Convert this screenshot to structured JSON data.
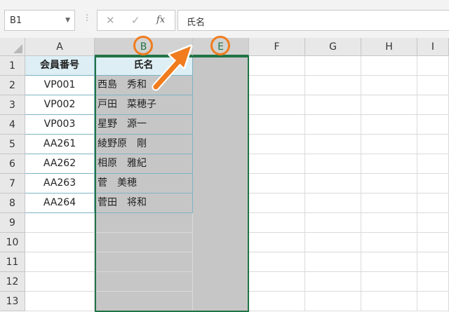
{
  "formula_bar": {
    "name_box": "B1",
    "formula": "氏名",
    "fx_label": "fx"
  },
  "columns": [
    "A",
    "B",
    "E",
    "F",
    "G",
    "H",
    "I"
  ],
  "rows": [
    "1",
    "2",
    "3",
    "4",
    "5",
    "6",
    "7",
    "8",
    "9",
    "10",
    "11",
    "12",
    "13"
  ],
  "table": {
    "headers": [
      "会員番号",
      "氏名"
    ],
    "records": [
      {
        "code": "VP001",
        "name": "西島　秀和"
      },
      {
        "code": "VP002",
        "name": "戸田　菜穂子"
      },
      {
        "code": "VP003",
        "name": "星野　源一"
      },
      {
        "code": "AA261",
        "name": "綾野原　剛"
      },
      {
        "code": "AA262",
        "name": "相原　雅紀"
      },
      {
        "code": "AA263",
        "name": "菅　美穂"
      },
      {
        "code": "AA264",
        "name": "菅田　将和"
      }
    ]
  },
  "colors": {
    "selection": "#217346",
    "annotation": "#f07c1e",
    "header_fill": "#ddeff4"
  }
}
